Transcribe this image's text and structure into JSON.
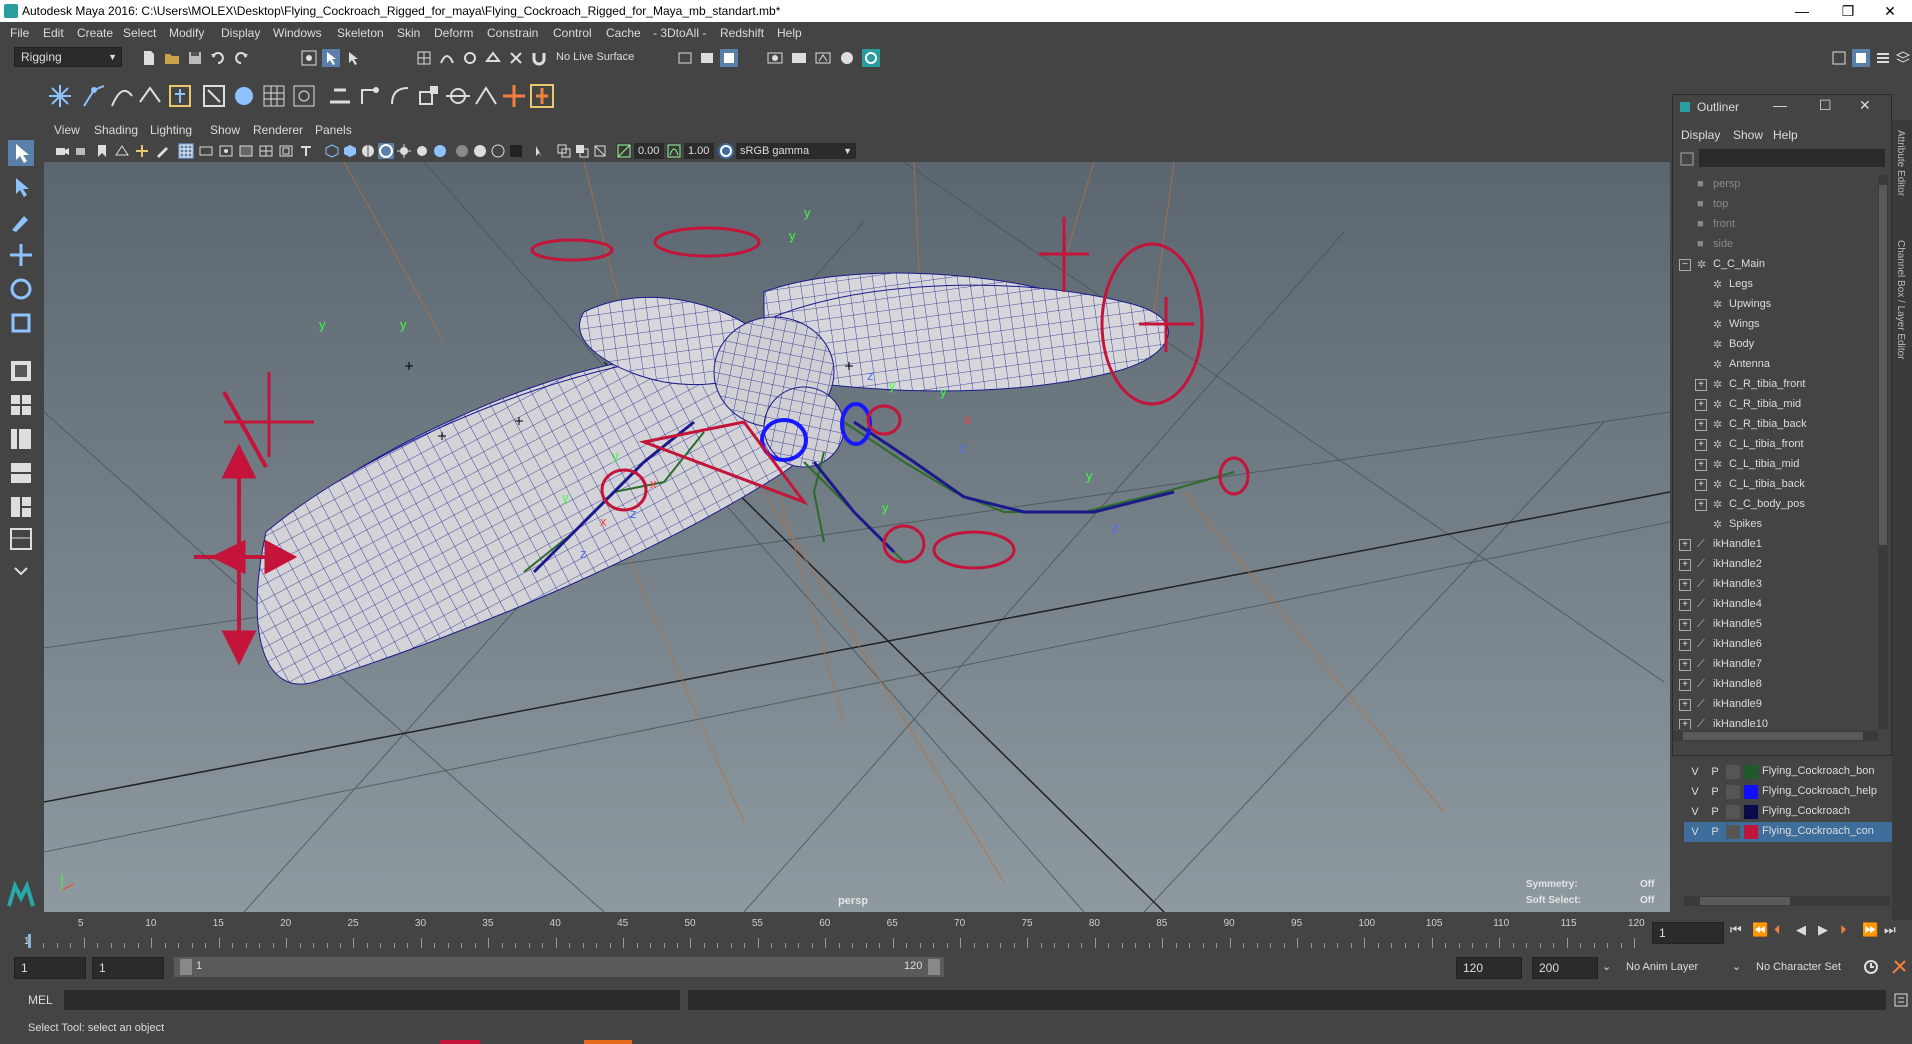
{
  "window": {
    "title": "Autodesk Maya 2016: C:\\Users\\MOLEX\\Desktop\\Flying_Cockroach_Rigged_for_maya\\Flying_Cockroach_Rigged_for_Maya_mb_standart.mb*",
    "minimize": "—",
    "restore": "❐",
    "close": "✕"
  },
  "menubar": [
    "File",
    "Edit",
    "Create",
    "Select",
    "Modify",
    "Display",
    "Windows",
    "Skeleton",
    "Skin",
    "Deform",
    "Constrain",
    "Control",
    "Cache",
    "- 3DtoAll -",
    "Redshift",
    "Help"
  ],
  "statusline": {
    "menuset": "Rigging",
    "live_surface": "No Live Surface"
  },
  "viewport": {
    "menu": [
      "View",
      "Shading",
      "Lighting",
      "Show",
      "Renderer",
      "Panels"
    ],
    "near_value": "0.00",
    "far_value": "1.00",
    "color_space": "sRGB gamma",
    "camera_label": "persp",
    "symmetry_label": "Symmetry:",
    "symmetry_value": "Off",
    "softselect_label": "Soft Select:",
    "softselect_value": "Off",
    "axis_labels": {
      "y": "y",
      "x": "x",
      "z": "z"
    }
  },
  "outliner": {
    "title": "Outliner",
    "menu": [
      "Display",
      "Show",
      "Help"
    ],
    "items": [
      {
        "label": "persp",
        "indent": 0,
        "kind": "camera",
        "dim": true,
        "exp": ""
      },
      {
        "label": "top",
        "indent": 0,
        "kind": "camera",
        "dim": true,
        "exp": ""
      },
      {
        "label": "front",
        "indent": 0,
        "kind": "camera",
        "dim": true,
        "exp": ""
      },
      {
        "label": "side",
        "indent": 0,
        "kind": "camera",
        "dim": true,
        "exp": ""
      },
      {
        "label": "C_C_Main",
        "indent": 0,
        "kind": "group",
        "dim": false,
        "exp": "−"
      },
      {
        "label": "Legs",
        "indent": 1,
        "kind": "group",
        "dim": false,
        "exp": ""
      },
      {
        "label": "Upwings",
        "indent": 1,
        "kind": "group",
        "dim": false,
        "exp": ""
      },
      {
        "label": "Wings",
        "indent": 1,
        "kind": "group",
        "dim": false,
        "exp": ""
      },
      {
        "label": "Body",
        "indent": 1,
        "kind": "group",
        "dim": false,
        "exp": ""
      },
      {
        "label": "Antenna",
        "indent": 1,
        "kind": "group",
        "dim": false,
        "exp": ""
      },
      {
        "label": "C_R_tibia_front",
        "indent": 1,
        "kind": "group",
        "dim": false,
        "exp": "+"
      },
      {
        "label": "C_R_tibia_mid",
        "indent": 1,
        "kind": "group",
        "dim": false,
        "exp": "+"
      },
      {
        "label": "C_R_tibia_back",
        "indent": 1,
        "kind": "group",
        "dim": false,
        "exp": "+"
      },
      {
        "label": "C_L_tibia_front",
        "indent": 1,
        "kind": "group",
        "dim": false,
        "exp": "+"
      },
      {
        "label": "C_L_tibia_mid",
        "indent": 1,
        "kind": "group",
        "dim": false,
        "exp": "+"
      },
      {
        "label": "C_L_tibia_back",
        "indent": 1,
        "kind": "group",
        "dim": false,
        "exp": "+"
      },
      {
        "label": "C_C_body_pos",
        "indent": 1,
        "kind": "group",
        "dim": false,
        "exp": "+"
      },
      {
        "label": "Spikes",
        "indent": 1,
        "kind": "group",
        "dim": false,
        "exp": ""
      },
      {
        "label": "ikHandle1",
        "indent": 0,
        "kind": "ik",
        "dim": false,
        "exp": "+"
      },
      {
        "label": "ikHandle2",
        "indent": 0,
        "kind": "ik",
        "dim": false,
        "exp": "+"
      },
      {
        "label": "ikHandle3",
        "indent": 0,
        "kind": "ik",
        "dim": false,
        "exp": "+"
      },
      {
        "label": "ikHandle4",
        "indent": 0,
        "kind": "ik",
        "dim": false,
        "exp": "+"
      },
      {
        "label": "ikHandle5",
        "indent": 0,
        "kind": "ik",
        "dim": false,
        "exp": "+"
      },
      {
        "label": "ikHandle6",
        "indent": 0,
        "kind": "ik",
        "dim": false,
        "exp": "+"
      },
      {
        "label": "ikHandle7",
        "indent": 0,
        "kind": "ik",
        "dim": false,
        "exp": "+"
      },
      {
        "label": "ikHandle8",
        "indent": 0,
        "kind": "ik",
        "dim": false,
        "exp": "+"
      },
      {
        "label": "ikHandle9",
        "indent": 0,
        "kind": "ik",
        "dim": false,
        "exp": "+"
      },
      {
        "label": "ikHandle10",
        "indent": 0,
        "kind": "ik",
        "dim": false,
        "exp": "+"
      }
    ]
  },
  "layers": [
    {
      "v": "V",
      "p": "P",
      "color": "#1e5a2a",
      "name": "Flying_Cockroach_bon",
      "selected": false
    },
    {
      "v": "V",
      "p": "P",
      "color": "#1010ff",
      "name": "Flying_Cockroach_help",
      "selected": false
    },
    {
      "v": "V",
      "p": "P",
      "color": "#0a0a4a",
      "name": "Flying_Cockroach",
      "selected": false
    },
    {
      "v": "V",
      "p": "P",
      "color": "#c0143c",
      "name": "Flying_Cockroach_con",
      "selected": true
    }
  ],
  "right_tabs": {
    "attribute_editor": "Attribute Editor",
    "channel_box": "Channel Box / Layer Editor"
  },
  "timeline": {
    "ticks": [
      5,
      10,
      15,
      20,
      25,
      30,
      35,
      40,
      45,
      50,
      55,
      60,
      65,
      70,
      75,
      80,
      85,
      90,
      95,
      100,
      105,
      110,
      115,
      120
    ],
    "first_tick": "1",
    "current_frame": "1",
    "range_start": "1",
    "range_playback_start": "1",
    "range_bar_start": "1",
    "range_bar_end": "120",
    "range_end": "120",
    "anim_end": "200",
    "anim_layer": "No Anim Layer",
    "character_set": "No Character Set"
  },
  "cmdline": {
    "label": "MEL"
  },
  "helpline": {
    "text": "Select Tool: select an object"
  },
  "colors": {
    "accent_blue": "#3e6d9c",
    "control_red": "#c4143a",
    "mesh_wire": "#1a1a8c",
    "ik_green": "#2d6b2d"
  }
}
